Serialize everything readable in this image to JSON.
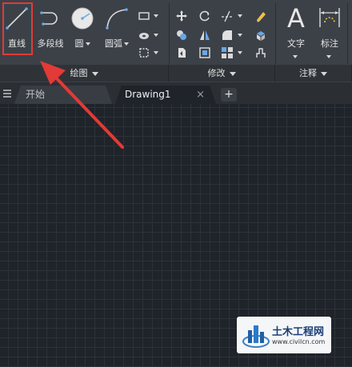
{
  "ribbon": {
    "draw_tools": {
      "line": "直线",
      "polyline": "多段线",
      "circle": "圆",
      "arc": "圆弧"
    },
    "annotation_tools": {
      "text": "文字",
      "dimension": "标注"
    },
    "panels": {
      "draw": "绘图",
      "modify": "修改",
      "annotation": "注释"
    }
  },
  "tabs": {
    "start": "开始",
    "drawing": "Drawing1",
    "close_glyph": "×",
    "new_glyph": "+"
  },
  "watermark": {
    "brand": "土木工程网",
    "url": "www.civilcn.com"
  },
  "colors": {
    "highlight_box": "#e23a36",
    "arrow": "#e23a36",
    "ribbon_bg": "#3c4148",
    "canvas_bg": "#1f232a",
    "grid": "#2d3239"
  }
}
